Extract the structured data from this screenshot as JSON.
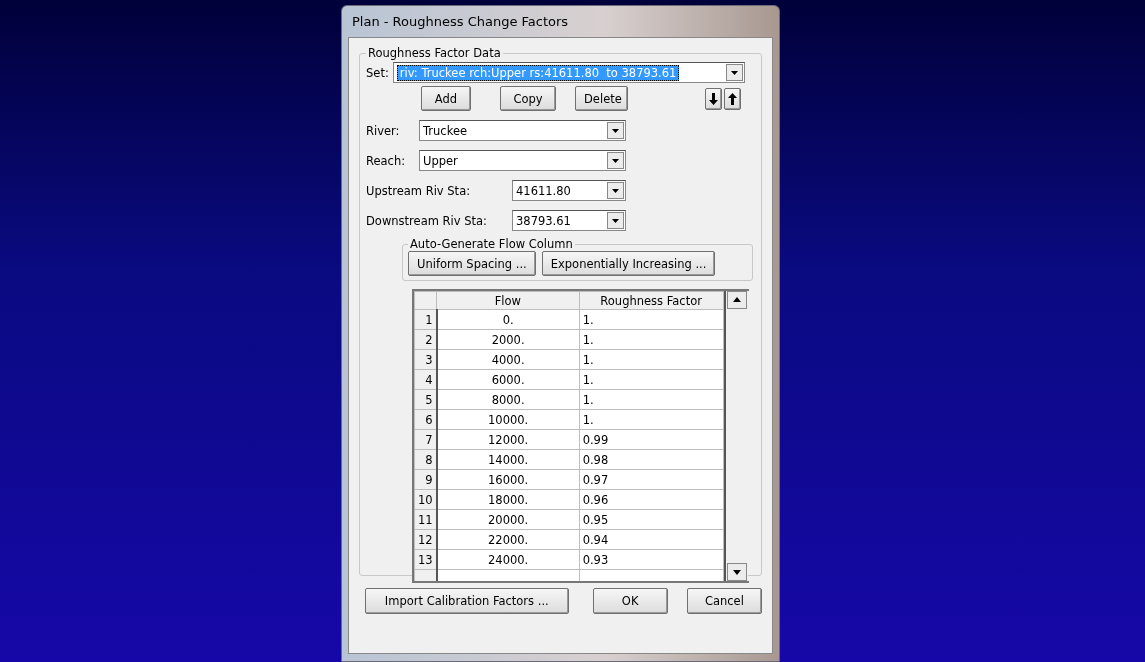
{
  "window": {
    "title": "Plan - Roughness Change Factors"
  },
  "group": {
    "title": "Roughness Factor Data"
  },
  "set": {
    "label": "Set:",
    "value": "riv: Truckee rch:Upper rs:41611.80  to 38793.61",
    "selected": true
  },
  "set_buttons": [
    "Add",
    "Copy",
    "Delete"
  ],
  "fields": [
    {
      "label": "River:",
      "value": "Truckee",
      "kind": "wide"
    },
    {
      "label": "Reach:",
      "value": "Upper",
      "kind": "wide"
    },
    {
      "label": "Upstream Riv Sta:",
      "value": "41611.80",
      "kind": "narrow"
    },
    {
      "label": "Downstream Riv Sta:",
      "value": "38793.61",
      "kind": "narrow"
    }
  ],
  "auto_generate": {
    "title": "Auto-Generate Flow Column",
    "buttons": [
      "Uniform Spacing ...",
      "Exponentially Increasing ..."
    ]
  },
  "table": {
    "columns": [
      "Flow",
      "Roughness Factor"
    ],
    "rows": [
      {
        "number": "1",
        "flow": "0.",
        "factor": "1."
      },
      {
        "number": "2",
        "flow": "2000.",
        "factor": "1."
      },
      {
        "number": "3",
        "flow": "4000.",
        "factor": "1."
      },
      {
        "number": "4",
        "flow": "6000.",
        "factor": "1."
      },
      {
        "number": "5",
        "flow": "8000.",
        "factor": "1."
      },
      {
        "number": "6",
        "flow": "10000.",
        "factor": "1."
      },
      {
        "number": "7",
        "flow": "12000.",
        "factor": "0.99"
      },
      {
        "number": "8",
        "flow": "14000.",
        "factor": "0.98"
      },
      {
        "number": "9",
        "flow": "16000.",
        "factor": "0.97"
      },
      {
        "number": "10",
        "flow": "18000.",
        "factor": "0.96"
      },
      {
        "number": "11",
        "flow": "20000.",
        "factor": "0.95"
      },
      {
        "number": "12",
        "flow": "22000.",
        "factor": "0.94"
      },
      {
        "number": "13",
        "flow": "24000.",
        "factor": "0.93"
      }
    ]
  },
  "footer_buttons": [
    "Import Calibration Factors ...",
    "OK",
    "Cancel"
  ]
}
